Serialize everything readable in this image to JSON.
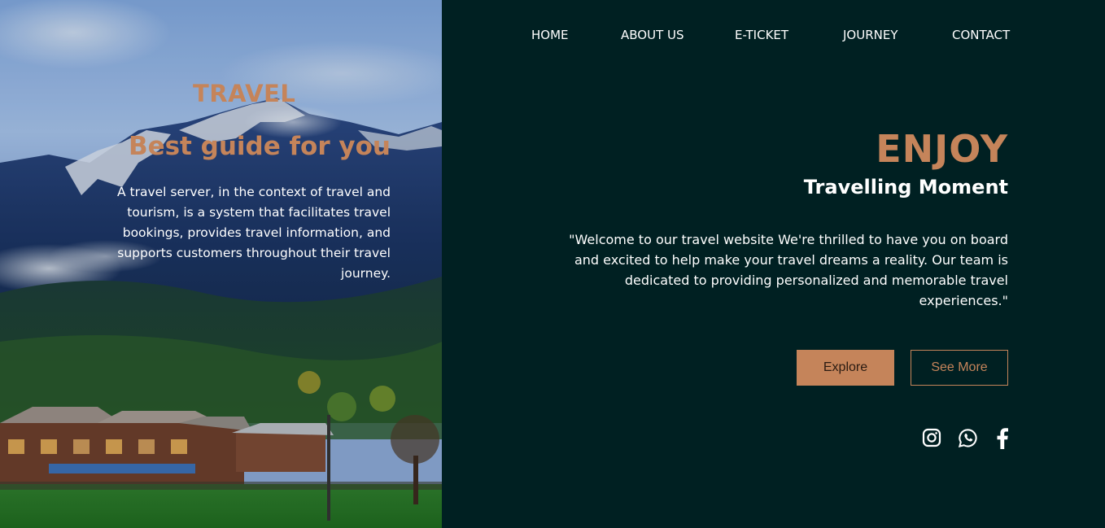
{
  "nav": {
    "items": [
      "HOME",
      "ABOUT US",
      "E-TICKET",
      "JOURNEY",
      "CONTACT"
    ]
  },
  "hero": {
    "kicker": "TRAVEL",
    "title": "Best guide for you",
    "description": "A travel server, in the context of travel and tourism, is a system that facilitates travel bookings, provides travel information, and supports customers throughout their travel journey."
  },
  "main": {
    "headline": "ENJOY",
    "subheadline": "Travelling Moment",
    "quote": "\"Welcome to our travel website We're thrilled to have you on board and excited to help make your travel dreams a reality. Our team is dedicated to providing personalized and memorable travel experiences.\""
  },
  "buttons": {
    "explore": "Explore",
    "see_more": "See More"
  },
  "social": {
    "icons": [
      "instagram-icon",
      "whatsapp-icon",
      "facebook-icon"
    ]
  },
  "colors": {
    "background": "#002022",
    "accent": "#c5845a",
    "text": "#ffffff"
  }
}
